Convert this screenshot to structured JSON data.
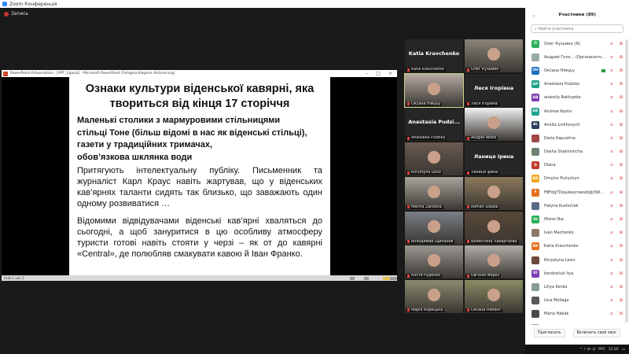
{
  "window": {
    "title": "Zoom Конференція",
    "recording": "Запись"
  },
  "ppt": {
    "title": "PowerPoint-Präsentation - [PPT_Ugasia] - Microsoft PowerPoint (Fehlgeschlagene Aktivierung)",
    "status": "Folie 1 von 1",
    "slide": {
      "title": "Ознаки культури віденської кавярні, яка твориться від кінця 17 сторіччя",
      "bullets": [
        "Маленькі столики з мармуровими стільницями",
        "стільці Тоне (більш відомі в нас як віденські стільці),",
        "газети у традиційних тримачах,",
        "обов’язкова шклянка води"
      ],
      "paragraphs": [
        "Притягують інтелектуальну публіку. Письменник та журналіст Карл Краус навіть жартував, що у віденських кав’ярнях таланти сидять так близько, що заважають один одному розвиватися …",
        "Відомими відвідувачами віденські кав’ярні хваляться до сьогодні, а щоб зануритися в цю особливу атмосферу туристи готові навіть стояти у черзі – як от до кавярні «Central», де полюбляв смакувати кавою й Іван Франко."
      ]
    }
  },
  "gallery": [
    {
      "name": "Katia Kravchenko",
      "big": "Katia Kravchenko"
    },
    {
      "name": "Олег Кузьмин",
      "photo": "#8a8478"
    },
    {
      "name": "Оксана Німцьу",
      "photo": "#b5aaa0",
      "active": true
    },
    {
      "name": "Леся Ігорівна",
      "big": "Леся Ігорівна"
    },
    {
      "name": "Anastasia Pudziey",
      "big": "Anastasia Pudzi..."
    },
    {
      "name": "Андрій Wood",
      "photo": "#f2f2f2"
    },
    {
      "name": "Khrystyna Lesiv",
      "photo": "#6a5a52"
    },
    {
      "name": "Ланиця Ірина",
      "big": "Ланиця Ірина"
    },
    {
      "name": "Marina Zaitseva",
      "photo": "#a8a49c"
    },
    {
      "name": "Roman Sobala",
      "photo": "#8c7a5c"
    },
    {
      "name": "Володимир Щипанов",
      "photo": "#7a7f86"
    },
    {
      "name": "Валентина Лабартаєва",
      "photo": "#5a4838"
    },
    {
      "name": "Костя Руденко",
      "photo": "#9a9690"
    },
    {
      "name": "Євгенія Мороз",
      "photo": "#b0aca6"
    },
    {
      "name": "Марія Корецька",
      "photo": "#8a8a70"
    },
    {
      "name": "Оксана Никонт",
      "photo": "#8c8c64"
    }
  ],
  "participants": {
    "header": "Участники (89)",
    "search_placeholder": "Найти участника",
    "invite": "Пригласить",
    "unmute": "Включить свой звук",
    "items": [
      {
        "name": "Олег Кузьмин (Я)",
        "init": "O",
        "color": "#2eaf5a"
      },
      {
        "name": "Андрей Голо... (Организатор)",
        "init": "",
        "color": "#9aa"
      },
      {
        "name": "Оксана Німцьу",
        "init": "OH",
        "color": "#1e6fc0",
        "video": true
      },
      {
        "name": "Anastasia Pudziey",
        "init": "AP",
        "color": "#1fa38a"
      },
      {
        "name": "anatoliy Bakhyeba",
        "init": "AB",
        "color": "#7d3fb5"
      },
      {
        "name": "Andrew Kostiv",
        "init": "AK",
        "color": "#1fa38a"
      },
      {
        "name": "Ankita Livkhovych",
        "init": "AL",
        "color": "#2c3e5c"
      },
      {
        "name": "Daria Kapustina",
        "init": "",
        "color": "#a04848"
      },
      {
        "name": "Dasha Shakovincha",
        "init": "",
        "color": "#708070"
      },
      {
        "name": "Diana",
        "init": "D",
        "color": "#c0392b"
      },
      {
        "name": "Dmytro Pulryshyn",
        "init": "DP",
        "color": "#f0a820"
      },
      {
        "name": "FBFdgTDzaukeymwodigb3WTAe...",
        "init": "F",
        "color": "#e67020"
      },
      {
        "name": "Halyna Kushnirak",
        "init": "",
        "color": "#5a6a8a"
      },
      {
        "name": "Iftone Ilka",
        "init": "IH",
        "color": "#2eaf5a"
      },
      {
        "name": "Ivan Machenko",
        "init": "",
        "color": "#8a7a6a"
      },
      {
        "name": "Katia Kravchenko",
        "init": "KK",
        "color": "#e67020"
      },
      {
        "name": "Khrystyna Lesiv",
        "init": "",
        "color": "#6a4a3a"
      },
      {
        "name": "kondratiuk Ilya",
        "init": "KI",
        "color": "#7d3fb5"
      },
      {
        "name": "Liliya Ilenko",
        "init": "",
        "color": "#8a9a9a"
      },
      {
        "name": "Lina Mollaga",
        "init": "",
        "color": "#5a5a5a"
      },
      {
        "name": "Maria Habak",
        "init": "",
        "color": "#4a4a4a"
      },
      {
        "name": "Maria Kovalskaa",
        "init": "",
        "color": "#9a9a9a"
      }
    ]
  },
  "taskbar": {
    "lang": "РУС",
    "time": "11:20"
  }
}
